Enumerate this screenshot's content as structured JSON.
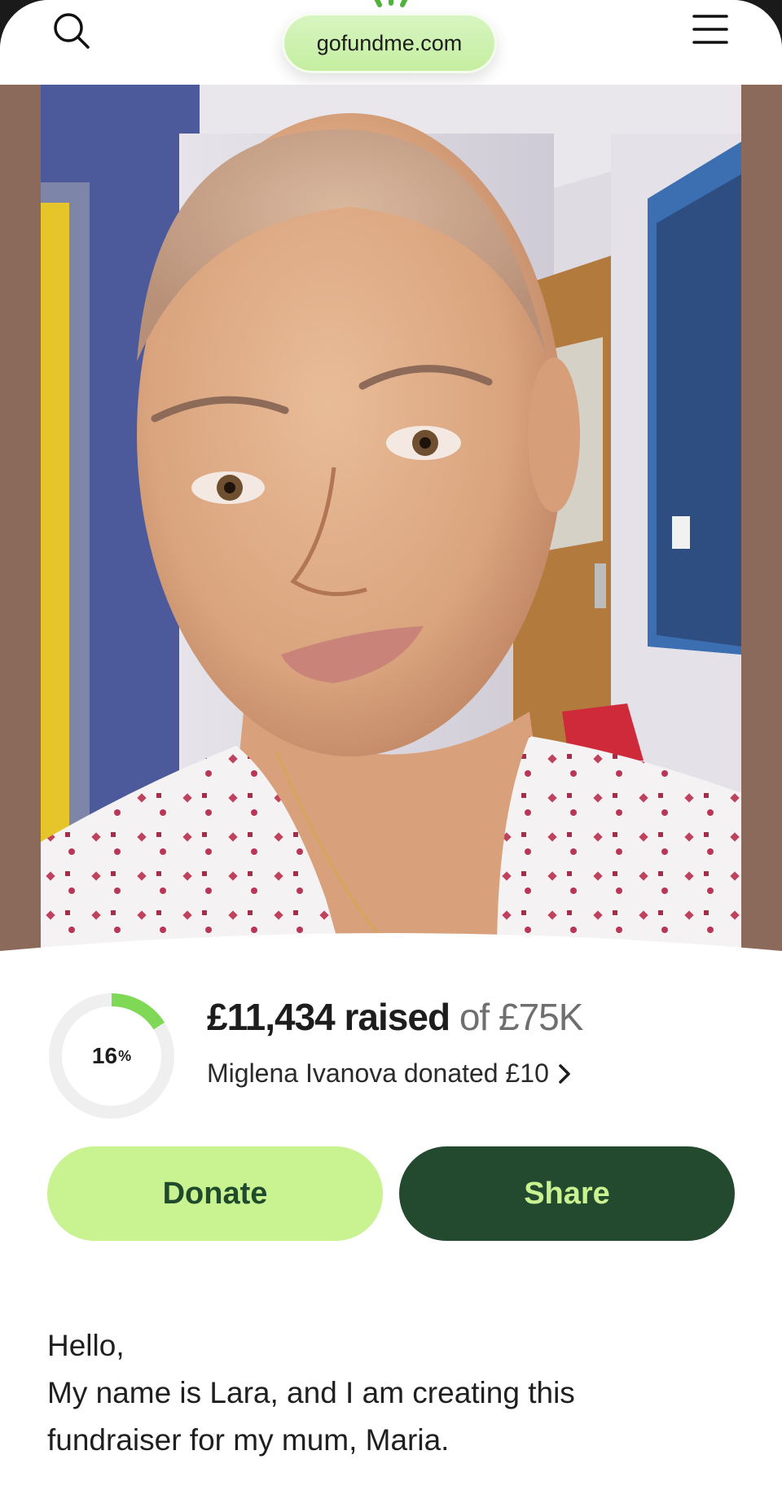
{
  "browser": {
    "url": "gofundme.com"
  },
  "icons": {
    "search": "search-icon",
    "menu": "hamburger-menu-icon",
    "chevron": "chevron-right-icon"
  },
  "gallery": {
    "slide_count": 4,
    "active_slide": 2
  },
  "progress": {
    "percent_value": "16",
    "percent_sign": "%",
    "fraction": 0.16
  },
  "fundraiser": {
    "amount_raised": "£11,434 raised",
    "goal_text": "of £75K",
    "recent_donation": "Miglena Ivanova donated £10"
  },
  "actions": {
    "donate_label": "Donate",
    "share_label": "Share"
  },
  "story": {
    "line1": "Hello,",
    "line2": "My name is Lara, and I am creating this",
    "line3": "fundraiser for my mum, Maria."
  },
  "colors": {
    "brand_light_green": "#c9f291",
    "brand_dark_green": "#234a2e",
    "progress_green": "#7fd957",
    "ring_track": "#efefef"
  }
}
